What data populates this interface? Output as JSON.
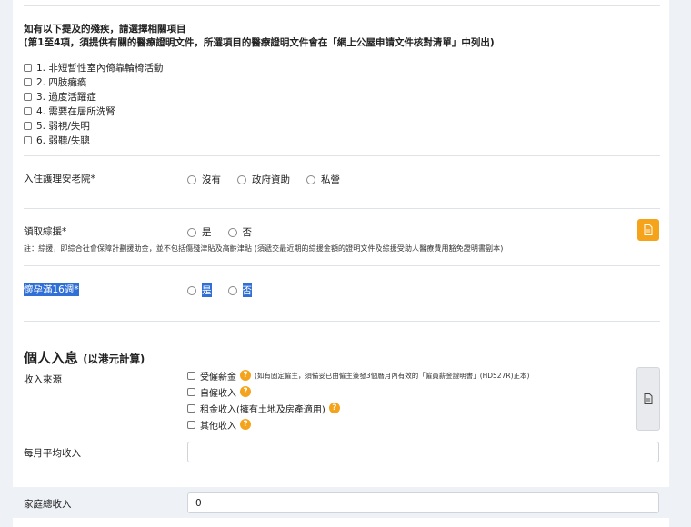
{
  "disability": {
    "title": "如有以下提及的殘疾，請選擇相關項目",
    "subtitle": "(第1至4項，須提供有關的醫療證明文件，所選項目的醫療證明文件會在「網上公屋申請文件核對清單」中列出)",
    "items": [
      "1. 非短暫性室內倚靠輪椅活動",
      "2. 四肢癱瘓",
      "3. 過度活躍症",
      "4. 需要在居所洗腎",
      "5. 弱視/失明",
      "6. 弱聽/失聰"
    ]
  },
  "elderly_home": {
    "label": "入住護理安老院*",
    "options": [
      "沒有",
      "政府資助",
      "私營"
    ]
  },
  "assistance": {
    "label": "領取綜援*",
    "options": [
      "是",
      "否"
    ],
    "note": "註：綜援，即綜合社會保障計劃援助金，並不包括傷殘津貼及高齡津貼 (須遞交最近期的綜援金額的證明文件及綜援受助人醫療費用豁免證明書副本)"
  },
  "pregnancy": {
    "label": "懷孕滿16週*",
    "options": [
      "是",
      "否"
    ]
  },
  "personal_income": {
    "title": "個人入息",
    "title_sub": "(以港元計算)",
    "source_label": "收入來源",
    "sources": [
      {
        "label": "受僱薪金",
        "note": "(如有固定僱主，須備妥已由僱主簽發3個曆月內有效的「僱員薪金證明書」(HD527R)正本)"
      },
      {
        "label": "自僱收入",
        "note": ""
      },
      {
        "label": "租金收入(擁有土地及房產適用)",
        "note": ""
      },
      {
        "label": "其他收入",
        "note": ""
      }
    ],
    "monthly_label": "每月平均收入",
    "monthly_value": "",
    "household_label": "家庭總收入",
    "household_value": "0"
  },
  "help_icon_text": "?",
  "colors": {
    "accent": "#f4a31b",
    "selection": "#2f6fd6",
    "band": "#eef1f5"
  },
  "icons": {
    "document": "document-icon",
    "help": "question-icon"
  }
}
